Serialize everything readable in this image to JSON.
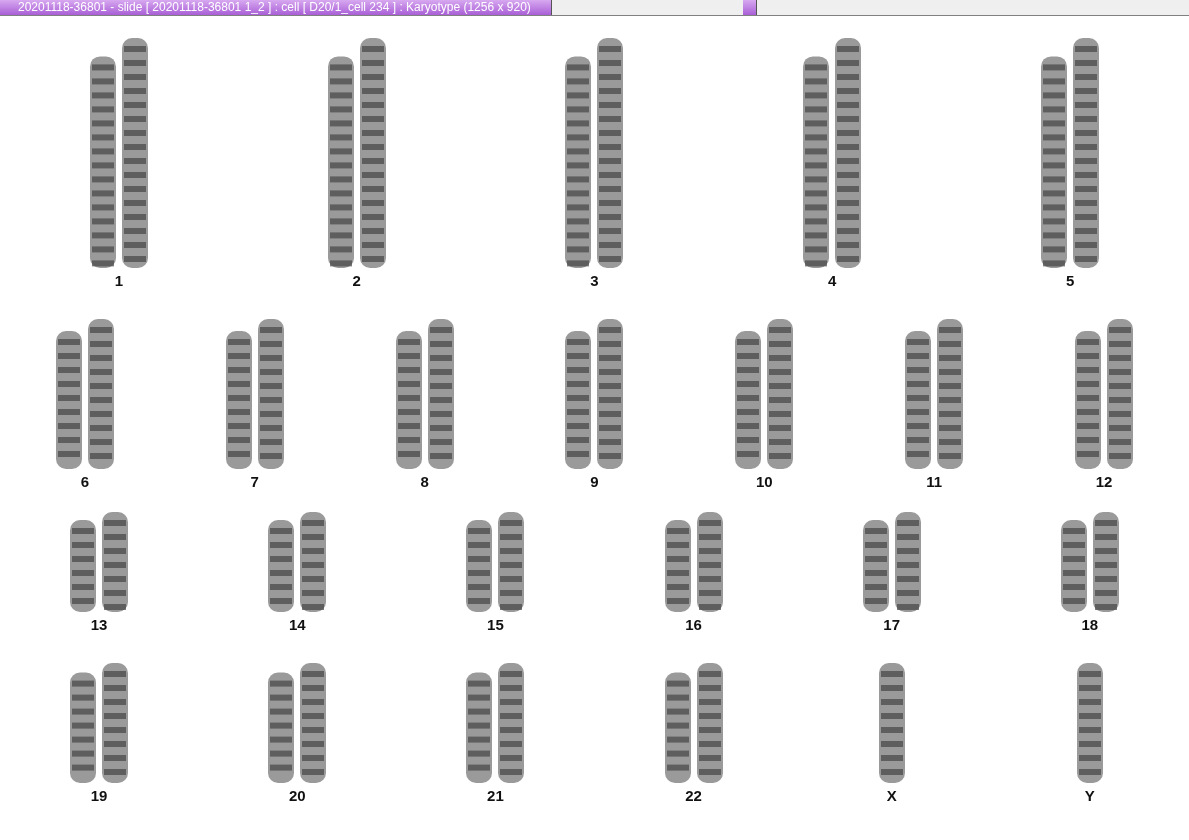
{
  "window": {
    "title": "20201118-36801 - slide [ 20201118-36801 1_2 ] : cell [ D20/1_cell 234 ] : Karyotype  (1256 x 920)"
  },
  "rows": [
    {
      "items": [
        {
          "label": "1",
          "kind": "pair"
        },
        {
          "label": "2",
          "kind": "pair"
        },
        {
          "label": "3",
          "kind": "pair"
        },
        {
          "label": "4",
          "kind": "pair"
        },
        {
          "label": "5",
          "kind": "pair"
        }
      ]
    },
    {
      "items": [
        {
          "label": "6",
          "kind": "pair"
        },
        {
          "label": "7",
          "kind": "pair"
        },
        {
          "label": "8",
          "kind": "pair"
        },
        {
          "label": "9",
          "kind": "pair"
        },
        {
          "label": "10",
          "kind": "pair"
        },
        {
          "label": "11",
          "kind": "pair"
        },
        {
          "label": "12",
          "kind": "pair"
        }
      ]
    },
    {
      "items": [
        {
          "label": "13",
          "kind": "pair"
        },
        {
          "label": "14",
          "kind": "pair"
        },
        {
          "label": "15",
          "kind": "pair"
        },
        {
          "label": "16",
          "kind": "pair"
        },
        {
          "label": "17",
          "kind": "pair"
        },
        {
          "label": "18",
          "kind": "pair"
        }
      ]
    },
    {
      "items": [
        {
          "label": "19",
          "kind": "pair"
        },
        {
          "label": "20",
          "kind": "pair"
        },
        {
          "label": "21",
          "kind": "pair"
        },
        {
          "label": "22",
          "kind": "pair"
        },
        {
          "label": "X",
          "kind": "single"
        },
        {
          "label": "Y",
          "kind": "single"
        }
      ]
    }
  ]
}
